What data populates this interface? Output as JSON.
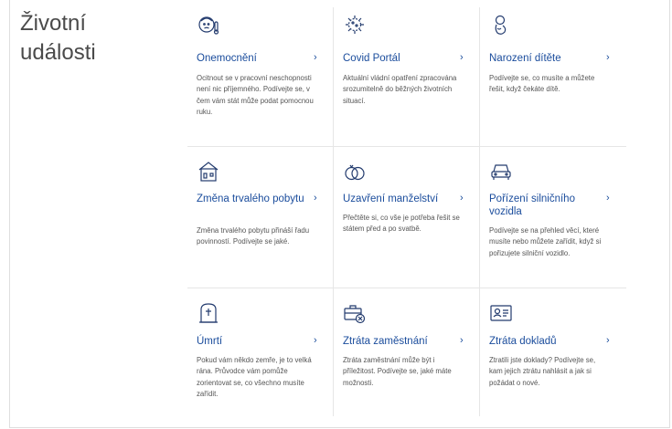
{
  "page": {
    "title_line1": "Životní",
    "title_line2": "události"
  },
  "colors": {
    "link": "#1a4c9c",
    "icon": "#233b6e",
    "text": "#555555",
    "divider": "#e6e6e6"
  },
  "cards": [
    {
      "icon": "sick-face-thermometer-icon",
      "title": "Onemocnění",
      "chevron": "›",
      "description": "Ocitnout se v pracovní neschopnosti není nic příjemného. Podívejte se, v čem vám stát může podat pomocnou ruku."
    },
    {
      "icon": "virus-icon",
      "title": "Covid Portál",
      "chevron": "›",
      "description": "Aktuální vládní opatření zpracována srozumitelně do běžných životních situací."
    },
    {
      "icon": "baby-icon",
      "title": "Narození dítěte",
      "chevron": "›",
      "description": "Podívejte se, co musíte a můžete řešit, když čekáte dítě."
    },
    {
      "icon": "house-icon",
      "title": "Změna trvalého pobytu",
      "chevron": "›",
      "description": "Změna trvalého pobytu přináší řadu povinností. Podívejte se jaké."
    },
    {
      "icon": "wedding-rings-icon",
      "title": "Uzavření manželství",
      "chevron": "›",
      "description": "Přečtěte si, co vše je potřeba řešit se státem před a po svatbě."
    },
    {
      "icon": "car-icon",
      "title": "Pořízení silničního vozidla",
      "chevron": "›",
      "description": "Podívejte se na přehled věcí, které musíte nebo můžete zařídit, když si pořizujete silniční vozidlo."
    },
    {
      "icon": "gravestone-icon",
      "title": "Úmrtí",
      "chevron": "›",
      "description": "Pokud vám někdo zemře, je to velká rána. Průvodce vám pomůže zorientovat se, co všechno musíte zařídit."
    },
    {
      "icon": "briefcase-cancel-icon",
      "title": "Ztráta zaměstnání",
      "chevron": "›",
      "description": "Ztráta zaměstnání může být i příležitost. Podívejte se, jaké máte možnosti."
    },
    {
      "icon": "id-card-icon",
      "title": "Ztráta dokladů",
      "chevron": "›",
      "description": "Ztratili jste doklady? Podívejte se, kam jejich ztrátu nahlásit a jak si požádat o nové."
    }
  ]
}
